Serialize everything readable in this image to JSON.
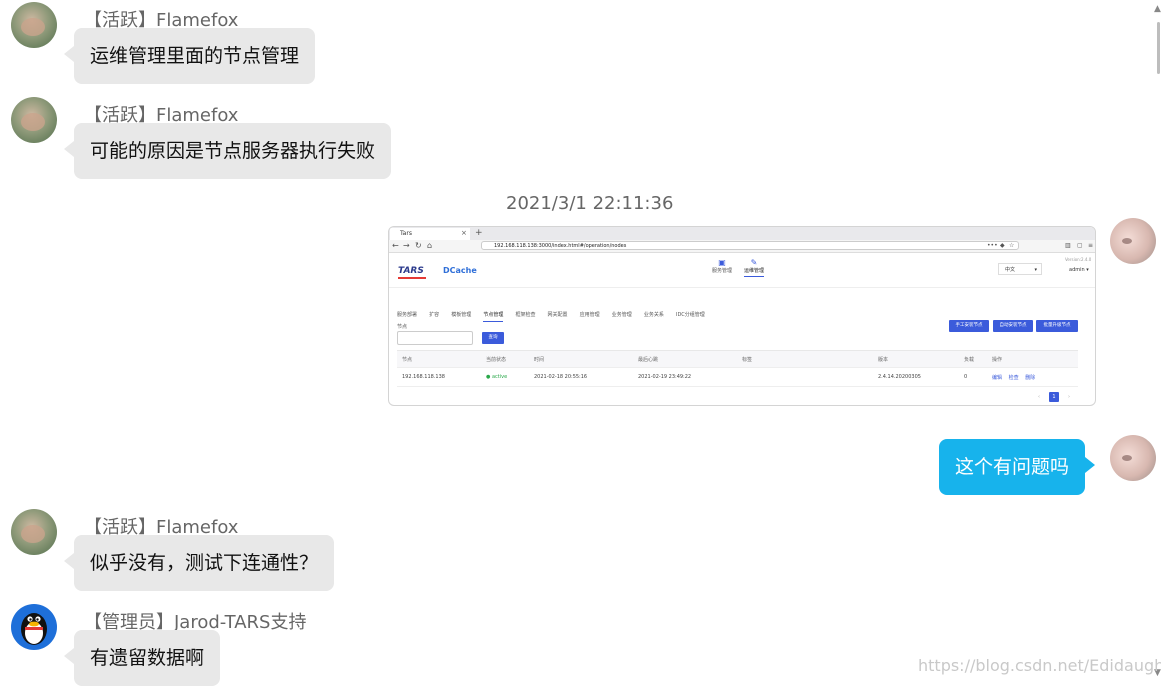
{
  "messages": [
    {
      "sender": "【活跃】Flamefox",
      "text": "运维管理里面的节点管理"
    },
    {
      "sender": "【活跃】Flamefox",
      "text": "可能的原因是节点服务器执行失败"
    },
    {
      "sender": "",
      "text": "这个有问题吗"
    },
    {
      "sender": "【活跃】Flamefox",
      "text": "似乎没有，测试下连通性？"
    },
    {
      "sender": "【管理员】Jarod-TARS支持",
      "text": "有遗留数据啊"
    }
  ],
  "timestamp": "2021/3/1 22:11:36",
  "watermark": "https://blog.csdn.net/Edidaughter",
  "screenshot": {
    "tab_title": "Tars",
    "url": "192.168.118.138:3000/index.html#/operation/nodes",
    "logo_tars": "TARS",
    "logo_dcache": "DCache",
    "topnav": [
      "服务管理",
      "运维管理"
    ],
    "lang": "中文",
    "version": "Version:2.4.0",
    "user": "admin",
    "subnav": [
      "服务部署",
      "扩容",
      "模板管理",
      "节点管理",
      "框架检查",
      "网关配置",
      "应用管理",
      "业务管理",
      "业务关系",
      "IDC分组管理"
    ],
    "search_label": "节点",
    "search_button": "查询",
    "action_buttons": [
      "手工安装节点",
      "自动安装节点",
      "批量升级节点"
    ],
    "table": {
      "headers": [
        "节点",
        "当前状态",
        "时间",
        "最后心跳",
        "标签",
        "版本",
        "负载",
        "操作"
      ],
      "row": [
        "192.168.118.138",
        "● active",
        "2021-02-18 20:55:16",
        "2021-02-19 23:49:22",
        "",
        "2.4.14.20200305",
        "0"
      ],
      "ops": [
        "编辑",
        "检查",
        "删除"
      ]
    },
    "pagination": {
      "prev": "‹",
      "current": "1",
      "next": "›"
    }
  },
  "colors": {
    "incoming_bubble": "#e8e8e8",
    "outgoing_bubble": "#17b3ec",
    "accent": "#3b5bdb"
  }
}
